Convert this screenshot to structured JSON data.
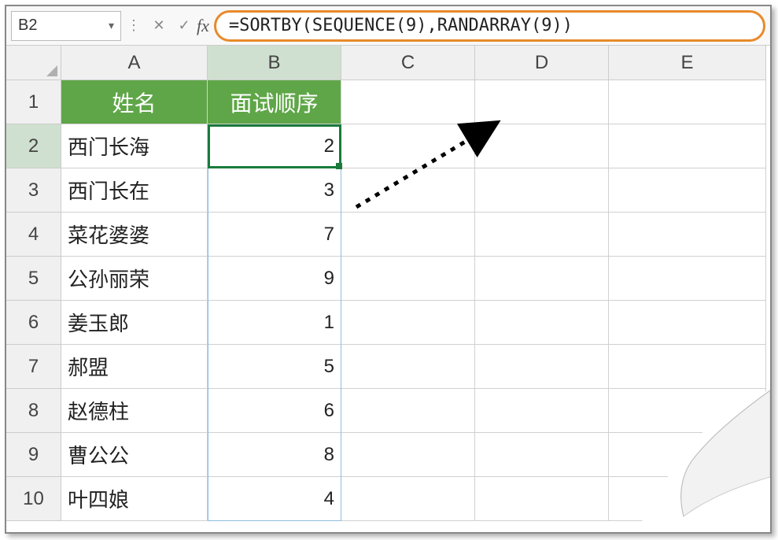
{
  "name_box": {
    "value": "B2"
  },
  "formula_bar": {
    "formula": "=SORTBY(SEQUENCE(9),RANDARRAY(9))"
  },
  "columns": [
    "A",
    "B",
    "C",
    "D",
    "E"
  ],
  "active_columns": [
    "B"
  ],
  "rows": [
    "1",
    "2",
    "3",
    "4",
    "5",
    "6",
    "7",
    "8",
    "9",
    "10"
  ],
  "active_rows": [
    "2"
  ],
  "headers": {
    "colA": "姓名",
    "colB": "面试顺序"
  },
  "data_rows": [
    {
      "name": "西门长海",
      "order": "2"
    },
    {
      "name": "西门长在",
      "order": "3"
    },
    {
      "name": "菜花婆婆",
      "order": "7"
    },
    {
      "name": "公孙丽荣",
      "order": "9"
    },
    {
      "name": "姜玉郎",
      "order": "1"
    },
    {
      "name": "郝盟",
      "order": "5"
    },
    {
      "name": "赵德柱",
      "order": "6"
    },
    {
      "name": "曹公公",
      "order": "8"
    },
    {
      "name": "叶四娘",
      "order": "4"
    }
  ],
  "selected_cell": "B2",
  "colors": {
    "header_bg": "#5fa648",
    "selection": "#1a7a3c",
    "callout": "#e88a2a"
  }
}
